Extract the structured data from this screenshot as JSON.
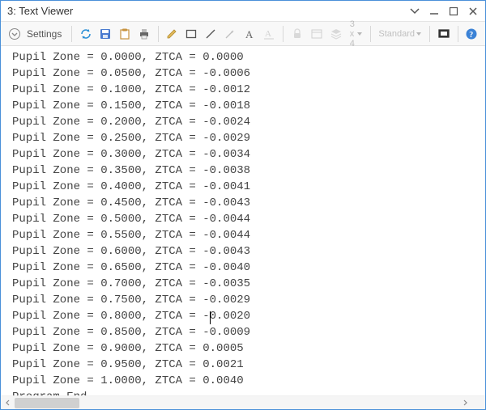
{
  "window": {
    "title": "3: Text Viewer"
  },
  "toolbar": {
    "settings_label": "Settings",
    "grid_label": "3 x 4",
    "style_label": "Standard"
  },
  "chart_data": {
    "type": "table",
    "title": "",
    "columns": [
      "Pupil Zone",
      "ZTCA"
    ],
    "rows": [
      [
        "0.0000",
        "0.0000"
      ],
      [
        "0.0500",
        "-0.0006"
      ],
      [
        "0.1000",
        "-0.0012"
      ],
      [
        "0.1500",
        "-0.0018"
      ],
      [
        "0.2000",
        "-0.0024"
      ],
      [
        "0.2500",
        "-0.0029"
      ],
      [
        "0.3000",
        "-0.0034"
      ],
      [
        "0.3500",
        "-0.0038"
      ],
      [
        "0.4000",
        "-0.0041"
      ],
      [
        "0.4500",
        "-0.0043"
      ],
      [
        "0.5000",
        "-0.0044"
      ],
      [
        "0.5500",
        "-0.0044"
      ],
      [
        "0.6000",
        "-0.0043"
      ],
      [
        "0.6500",
        "-0.0040"
      ],
      [
        "0.7000",
        "-0.0035"
      ],
      [
        "0.7500",
        "-0.0029"
      ],
      [
        "0.8000",
        "-0.0020"
      ],
      [
        "0.8500",
        "-0.0009"
      ],
      [
        "0.9000",
        "0.0005"
      ],
      [
        "0.9500",
        "0.0021"
      ],
      [
        "1.0000",
        "0.0040"
      ]
    ],
    "footer": "Program End",
    "cursor_row_index": 16,
    "cursor_col_offset_chars": 29
  }
}
